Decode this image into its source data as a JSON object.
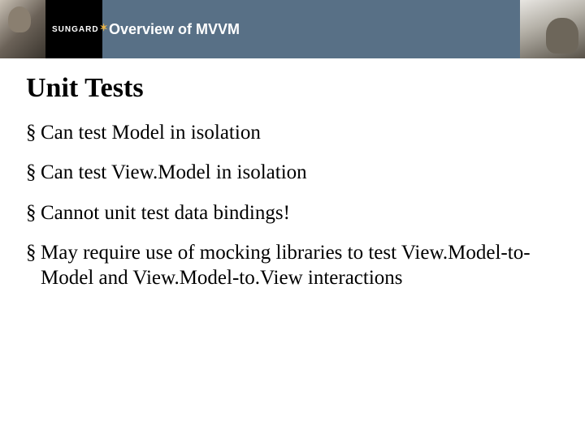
{
  "header": {
    "logo_text": "SUNGARD",
    "title": "Overview of MVVM"
  },
  "slide": {
    "heading": "Unit Tests",
    "bullets": [
      "Can test Model in isolation",
      "Can test View.Model in isolation",
      "Cannot unit test data bindings!",
      "May require use of mocking libraries to test View.Model-to-Model and View.Model-to.View interactions"
    ]
  }
}
